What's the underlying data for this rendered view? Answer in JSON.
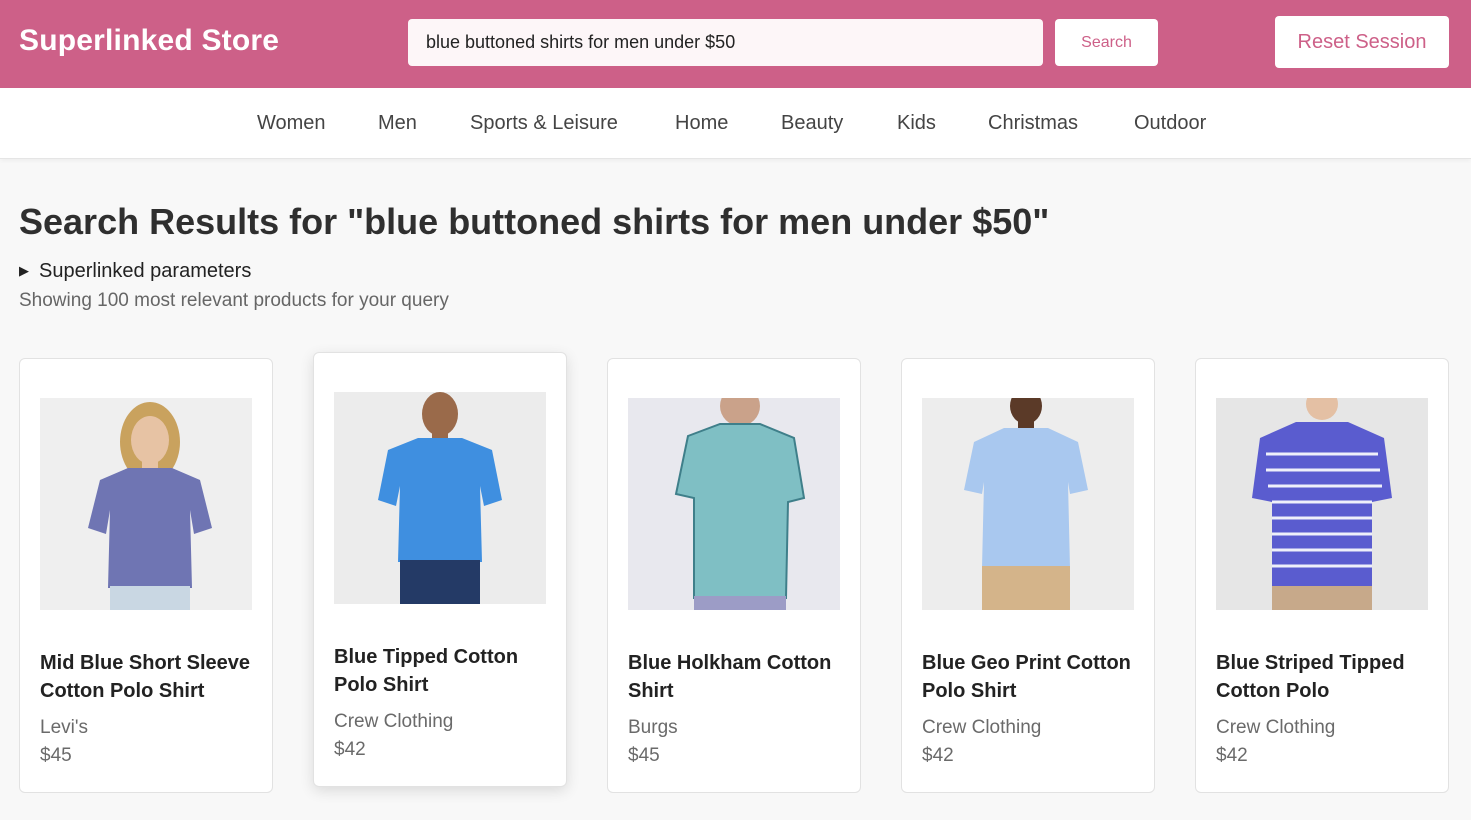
{
  "header": {
    "brand": "Superlinked Store",
    "search_value": "blue buttoned shirts for men under $50",
    "search_button": "Search",
    "reset_button": "Reset Session"
  },
  "nav": {
    "items": [
      "Women",
      "Men",
      "Sports & Leisure",
      "Home",
      "Beauty",
      "Kids",
      "Christmas",
      "Outdoor"
    ]
  },
  "results": {
    "title": "Search Results for \"blue buttoned shirts for men under $50\"",
    "params_label": "Superlinked parameters",
    "showing_text": "Showing 100 most relevant products for your query"
  },
  "products": [
    {
      "name": "Mid Blue Short Sleeve Cotton Polo Shirt",
      "brand": "Levi's",
      "price": "$45",
      "shirt_color": "#6f75b3",
      "bg_color": "#efefef"
    },
    {
      "name": "Blue Tipped Cotton Polo Shirt",
      "brand": "Crew Clothing",
      "price": "$42",
      "shirt_color": "#3f8fe0",
      "bg_color": "#ececec"
    },
    {
      "name": "Blue Holkham Cotton Shirt",
      "brand": "Burgs",
      "price": "$45",
      "shirt_color": "#7fbfc4",
      "bg_color": "#e8e8ee"
    },
    {
      "name": "Blue Geo Print Cotton Polo Shirt",
      "brand": "Crew Clothing",
      "price": "$42",
      "shirt_color": "#a9c8ef",
      "bg_color": "#ededed"
    },
    {
      "name": "Blue Striped Tipped Cotton Polo",
      "brand": "Crew Clothing",
      "price": "$42",
      "shirt_color": "#5a5ccf",
      "bg_color": "#e6e6e6"
    }
  ],
  "colors": {
    "accent": "#cd6088"
  }
}
